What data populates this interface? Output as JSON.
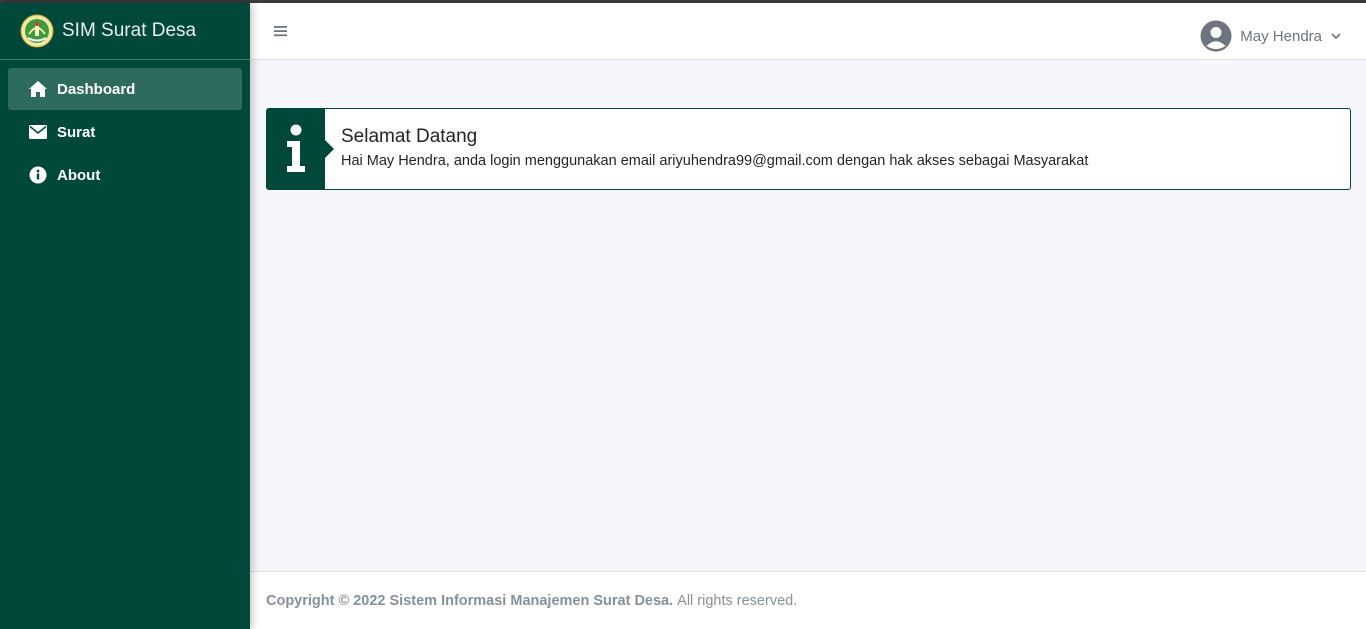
{
  "brand": {
    "title": "SIM Surat Desa",
    "logo_icon": "village-emblem-icon"
  },
  "sidebar": {
    "items": [
      {
        "label": "Dashboard",
        "icon": "home-icon",
        "active": true
      },
      {
        "label": "Surat",
        "icon": "envelope-icon",
        "active": false
      },
      {
        "label": "About",
        "icon": "info-circle-icon",
        "active": false
      }
    ]
  },
  "header": {
    "menu_icon": "hamburger-icon",
    "user": {
      "name": "May Hendra",
      "avatar_icon": "user-circle-icon",
      "dropdown_icon": "chevron-down-icon"
    }
  },
  "welcome": {
    "icon": "info-icon",
    "title": "Selamat Datang",
    "message": "Hai May Hendra, anda login menggunakan email ariyuhendra99@gmail.com dengan hak akses sebagai Masyarakat"
  },
  "footer": {
    "copyright": "Copyright © 2022 Sistem Informasi Manajemen Surat Desa.",
    "rights": "All rights reserved."
  },
  "colors": {
    "primary": "#00483a",
    "active_item": "#2e6a5e",
    "background": "#f4f6f9"
  }
}
